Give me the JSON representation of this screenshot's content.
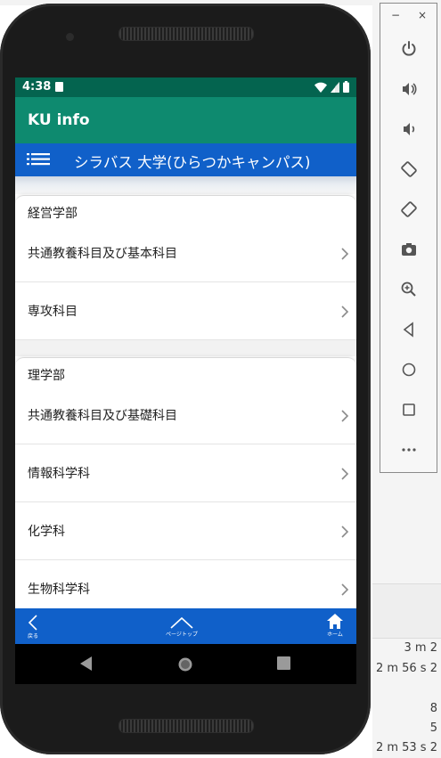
{
  "background": {
    "lines": [
      "3 m 2",
      "2 m 56 s 2",
      "8",
      "5",
      "2 m 53 s 2"
    ]
  },
  "tools": {
    "minimize": "−",
    "close": "×",
    "icons": [
      "power-icon",
      "volume-up-icon",
      "volume-down-icon",
      "rotate-left-icon",
      "rotate-right-icon",
      "camera-icon",
      "zoom-icon",
      "back-icon",
      "home-icon",
      "overview-icon",
      "more-icon"
    ]
  },
  "status": {
    "time": "4:38"
  },
  "app": {
    "title": "KU info"
  },
  "subheader": {
    "title": "シラバス 大学(ひらつかキャンパス)"
  },
  "sections": [
    {
      "header": "経営学部",
      "rows": [
        "共通教養科目及び基本科目",
        "専攻科目"
      ]
    },
    {
      "header": "理学部",
      "rows": [
        "共通教養科目及び基礎科目",
        "情報科学科",
        "化学科",
        "生物科学科"
      ]
    }
  ],
  "bottom_nav": {
    "back": "戻る",
    "top": "ページトップ",
    "home": "ホーム"
  },
  "colors": {
    "statusbar": "#04644f",
    "appbar": "#0e8a6f",
    "blue": "#1060c9"
  }
}
